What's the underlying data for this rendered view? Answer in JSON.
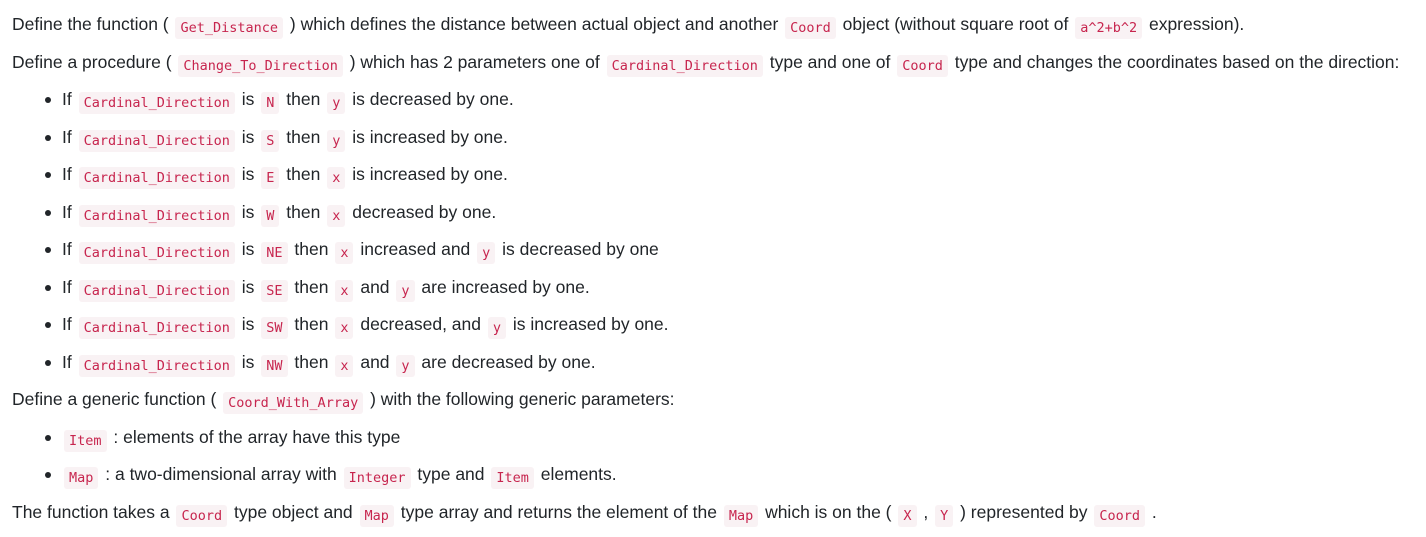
{
  "intro": {
    "p1": [
      "Define the function ( ",
      "Get_Distance",
      " ) which defines the distance between actual object and another ",
      "Coord",
      " object (without square root of ",
      "a^2+b^2",
      " expression)."
    ],
    "p2": [
      "Define a procedure ( ",
      "Change_To_Direction",
      " ) which has 2 parameters one of ",
      "Cardinal_Direction",
      " type and one of ",
      "Coord",
      " type and changes the coordinates based on the direction:"
    ]
  },
  "direction_rules": [
    [
      "If ",
      "Cardinal_Direction",
      " is ",
      "N",
      " then ",
      "y",
      " is decreased by one."
    ],
    [
      "If ",
      "Cardinal_Direction",
      " is ",
      "S",
      " then ",
      "y",
      " is increased by one."
    ],
    [
      "If ",
      "Cardinal_Direction",
      " is ",
      "E",
      " then ",
      "x",
      " is increased by one."
    ],
    [
      "If ",
      "Cardinal_Direction",
      " is ",
      "W",
      " then ",
      "x",
      " decreased by one."
    ],
    [
      "If ",
      "Cardinal_Direction",
      " is ",
      "NE",
      " then ",
      "x",
      " increased and ",
      "y",
      " is decreased by one"
    ],
    [
      "If ",
      "Cardinal_Direction",
      " is ",
      "SE",
      " then ",
      "x",
      " and ",
      "y",
      " are increased by one."
    ],
    [
      "If ",
      "Cardinal_Direction",
      " is ",
      "SW",
      " then ",
      "x",
      " decreased, and ",
      "y",
      " is increased by one."
    ],
    [
      "If ",
      "Cardinal_Direction",
      " is ",
      "NW",
      " then ",
      "x",
      " and ",
      "y",
      " are decreased by one."
    ]
  ],
  "generic": {
    "p3": [
      "Define a generic function ( ",
      "Coord_With_Array",
      " ) with the following generic parameters:"
    ],
    "params": [
      [
        "",
        "Item",
        " : elements of the array have this type"
      ],
      [
        "",
        "Map",
        " : a two-dimensional array with ",
        "Integer",
        " type and ",
        "Item",
        " elements."
      ]
    ],
    "p4": [
      "The function takes a ",
      "Coord",
      " type object and ",
      "Map",
      " type array and returns the element of the ",
      "Map",
      " which is on the ( ",
      "X",
      " , ",
      "Y",
      " ) represented by ",
      "Coord",
      " ."
    ]
  }
}
